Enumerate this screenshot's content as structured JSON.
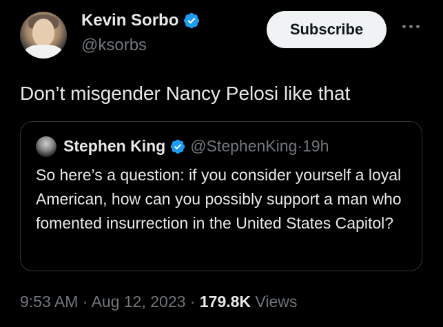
{
  "author": {
    "name": "Kevin Sorbo",
    "handle": "@ksorbs"
  },
  "subscribe_label": "Subscribe",
  "tweet": {
    "text": "Don’t misgender Nancy Pelosi like that"
  },
  "quoted": {
    "name": "Stephen King",
    "handle": "@StephenKing",
    "separator": " · ",
    "time": "19h",
    "text": "So here’s a question: if you consider yourself a loyal American, how can you possibly support a man who fomented insurrection in the United States Capitol?"
  },
  "meta": {
    "time": "9:53 AM",
    "separator1": " · ",
    "date": "Aug 12, 2023",
    "separator2": " · ",
    "views_count": "179.8K",
    "views_label": " Views"
  },
  "colors": {
    "background": "#000000",
    "verified_blue": "#1d9bf0",
    "secondary_text": "#71767b"
  },
  "icons": {
    "verified": "verified-badge-icon",
    "more": "more-options-icon"
  }
}
